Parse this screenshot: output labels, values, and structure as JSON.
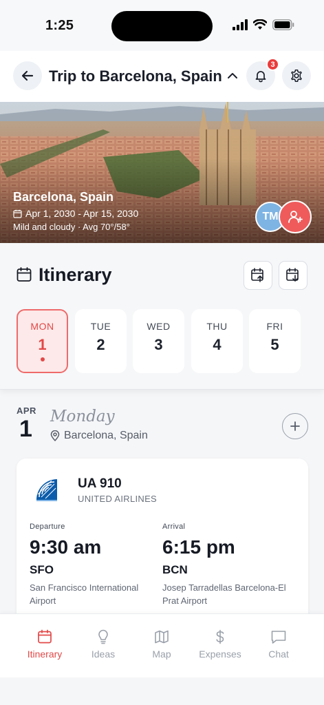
{
  "status_bar": {
    "time": "1:25"
  },
  "header": {
    "title": "Trip to Barcelona, Spain",
    "notification_count": "3"
  },
  "hero": {
    "city": "Barcelona, Spain",
    "dates": "Apr 1, 2030 - Apr 15, 2030",
    "weather": "Mild and cloudy · Avg 70°/58°",
    "avatar_initials": "TM"
  },
  "itinerary": {
    "title": "Itinerary",
    "days": [
      {
        "name": "MON",
        "num": "1",
        "active": true
      },
      {
        "name": "TUE",
        "num": "2",
        "active": false
      },
      {
        "name": "WED",
        "num": "3",
        "active": false
      },
      {
        "name": "THU",
        "num": "4",
        "active": false
      },
      {
        "name": "FRI",
        "num": "5",
        "active": false
      }
    ]
  },
  "day_detail": {
    "month": "APR",
    "day": "1",
    "weekday": "Monday",
    "location": "Barcelona, Spain"
  },
  "flight": {
    "number": "UA 910",
    "airline": "UNITED AIRLINES",
    "departure": {
      "label": "Departure",
      "time": "9:30 am",
      "code": "SFO",
      "airport": "San Francisco International Airport"
    },
    "arrival": {
      "label": "Arrival",
      "time": "6:15 pm",
      "code": "BCN",
      "airport": "Josep Tarradellas Barcelona-El Prat Airport"
    }
  },
  "tabs": [
    {
      "label": "Itinerary",
      "icon": "calendar-icon",
      "active": true
    },
    {
      "label": "Ideas",
      "icon": "lightbulb-icon",
      "active": false
    },
    {
      "label": "Map",
      "icon": "map-icon",
      "active": false
    },
    {
      "label": "Expenses",
      "icon": "dollar-icon",
      "active": false
    },
    {
      "label": "Chat",
      "icon": "chat-icon",
      "active": false
    }
  ],
  "colors": {
    "accent": "#e24848",
    "accent_light": "#fde9e9",
    "inactive": "#9aa0aa"
  }
}
